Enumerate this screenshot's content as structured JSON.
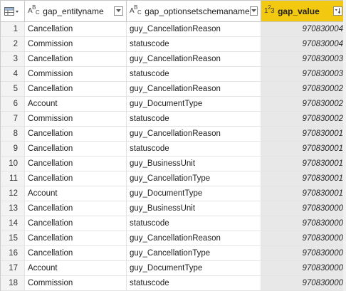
{
  "columns": [
    {
      "name": "gap_entityname",
      "type_icon": "ABC",
      "type": "text"
    },
    {
      "name": "gap_optionsetschemaname",
      "type_icon": "ABC",
      "type": "text"
    },
    {
      "name": "gap_value",
      "type_icon": "123",
      "type": "number"
    }
  ],
  "icons": {
    "table_menu": "table-menu-icon",
    "filter": "filter-dropdown-icon"
  },
  "colors": {
    "selected_header": "#f2c811",
    "selected_column": "#e8e8e8"
  },
  "rows": [
    {
      "idx": "1",
      "entity": "Cancellation",
      "optionset": "guy_CancellationReason",
      "value": "970830004"
    },
    {
      "idx": "2",
      "entity": "Commission",
      "optionset": "statuscode",
      "value": "970830004"
    },
    {
      "idx": "3",
      "entity": "Cancellation",
      "optionset": "guy_CancellationReason",
      "value": "970830003"
    },
    {
      "idx": "4",
      "entity": "Commission",
      "optionset": "statuscode",
      "value": "970830003"
    },
    {
      "idx": "5",
      "entity": "Cancellation",
      "optionset": "guy_CancellationReason",
      "value": "970830002"
    },
    {
      "idx": "6",
      "entity": "Account",
      "optionset": "guy_DocumentType",
      "value": "970830002"
    },
    {
      "idx": "7",
      "entity": "Commission",
      "optionset": "statuscode",
      "value": "970830002"
    },
    {
      "idx": "8",
      "entity": "Cancellation",
      "optionset": "guy_CancellationReason",
      "value": "970830001"
    },
    {
      "idx": "9",
      "entity": "Cancellation",
      "optionset": "statuscode",
      "value": "970830001"
    },
    {
      "idx": "10",
      "entity": "Cancellation",
      "optionset": "guy_BusinessUnit",
      "value": "970830001"
    },
    {
      "idx": "11",
      "entity": "Cancellation",
      "optionset": "guy_CancellationType",
      "value": "970830001"
    },
    {
      "idx": "12",
      "entity": "Account",
      "optionset": "guy_DocumentType",
      "value": "970830001"
    },
    {
      "idx": "13",
      "entity": "Cancellation",
      "optionset": "guy_BusinessUnit",
      "value": "970830000"
    },
    {
      "idx": "14",
      "entity": "Cancellation",
      "optionset": "statuscode",
      "value": "970830000"
    },
    {
      "idx": "15",
      "entity": "Cancellation",
      "optionset": "guy_CancellationReason",
      "value": "970830000"
    },
    {
      "idx": "16",
      "entity": "Cancellation",
      "optionset": "guy_CancellationType",
      "value": "970830000"
    },
    {
      "idx": "17",
      "entity": "Account",
      "optionset": "guy_DocumentType",
      "value": "970830000"
    },
    {
      "idx": "18",
      "entity": "Commission",
      "optionset": "statuscode",
      "value": "970830000"
    }
  ]
}
